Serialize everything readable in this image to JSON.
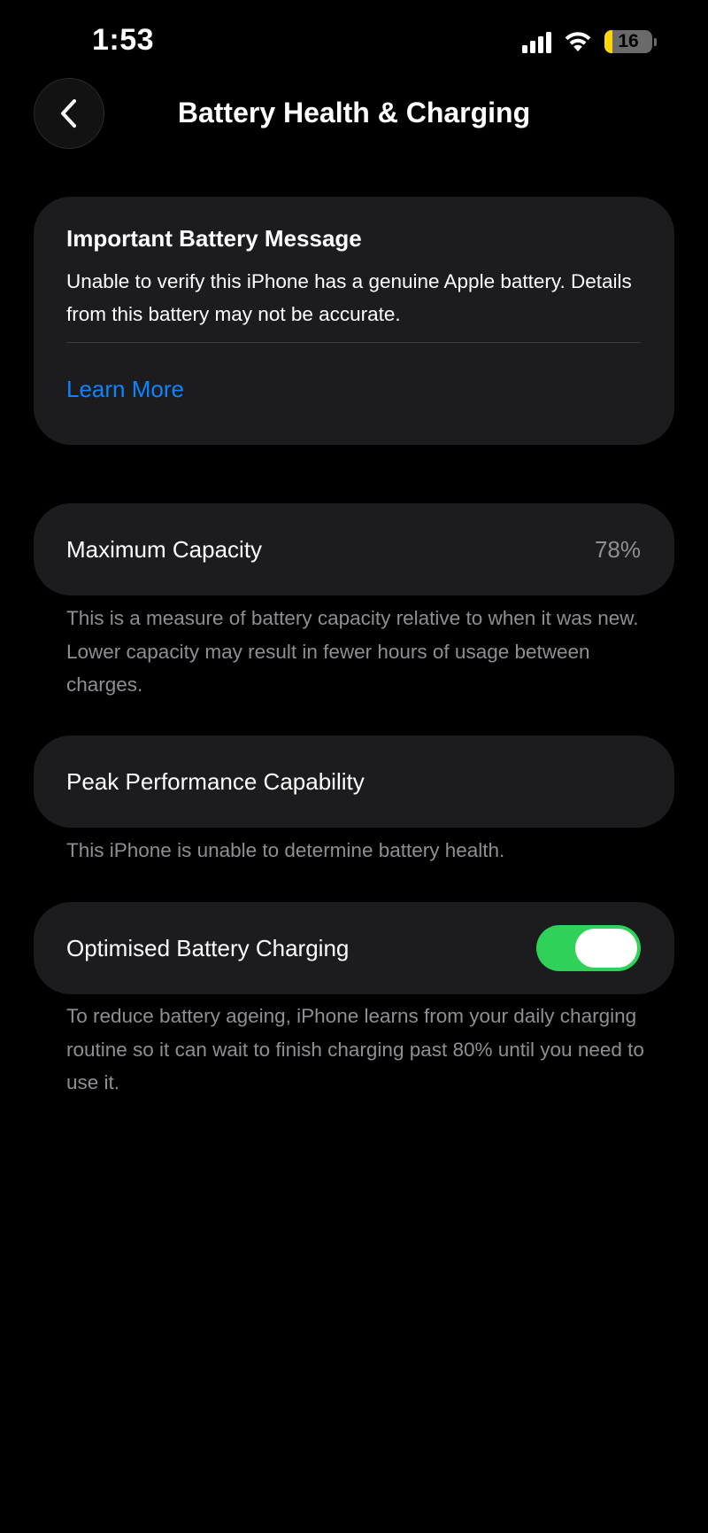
{
  "status_bar": {
    "time": "1:53",
    "signal_icon": "cellular-signal-icon",
    "wifi_icon": "wifi-icon",
    "battery_level": "16",
    "battery_fraction": 0.16,
    "battery_color": "#ffd60a"
  },
  "header": {
    "back_icon": "chevron-left-icon",
    "title": "Battery Health & Charging"
  },
  "important_message": {
    "title": "Important Battery Message",
    "body": "Unable to verify this iPhone has a genuine Apple battery. Details from this battery may not be accurate.",
    "link_label": "Learn More",
    "link_color": "#0a84ff"
  },
  "maximum_capacity": {
    "label": "Maximum Capacity",
    "value": "78%",
    "note": "This is a measure of battery capacity relative to when it was new. Lower capacity may result in fewer hours of usage between charges."
  },
  "peak_performance": {
    "label": "Peak Performance Capability",
    "note": "This iPhone is unable to determine battery health."
  },
  "optimised_charging": {
    "label": "Optimised Battery Charging",
    "enabled": true,
    "toggle_color": "#30d158",
    "note": "To reduce battery ageing, iPhone learns from your daily charging routine so it can wait to finish charging past 80% until you need to use it."
  }
}
